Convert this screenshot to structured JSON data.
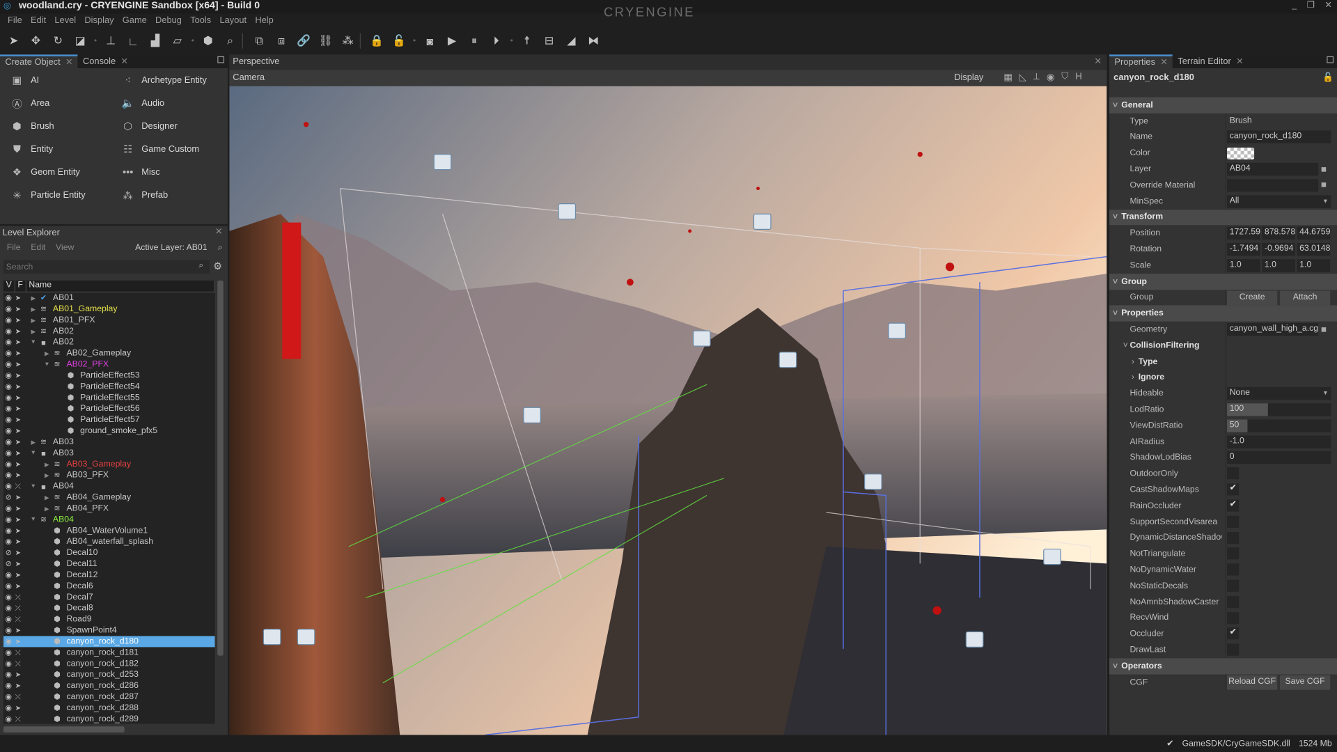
{
  "window": {
    "title": "woodland.cry - CRYENGINE Sandbox [x64] - Build 0",
    "brand": "CRYENGINE",
    "controls": [
      "_",
      "❐",
      "✕"
    ]
  },
  "menu": [
    "File",
    "Edit",
    "Level",
    "Display",
    "Game",
    "Debug",
    "Tools",
    "Layout",
    "Help"
  ],
  "toolbar": [
    {
      "name": "select",
      "g": "➤"
    },
    {
      "name": "move",
      "g": "✥"
    },
    {
      "name": "rotate",
      "g": "↻"
    },
    {
      "name": "scale",
      "g": "◪"
    },
    {
      "name": "dot"
    },
    {
      "name": "snap-grid",
      "g": "⊥"
    },
    {
      "name": "snap-angle",
      "g": "∟"
    },
    {
      "name": "snap-scale",
      "g": "▟"
    },
    {
      "name": "snap-terrain",
      "g": "▱"
    },
    {
      "name": "dot"
    },
    {
      "name": "select-object",
      "g": "⬢"
    },
    {
      "name": "find",
      "g": "⌕"
    },
    {
      "name": "sep"
    },
    {
      "name": "group",
      "g": "⧉"
    },
    {
      "name": "ungroup",
      "g": "⧈"
    },
    {
      "name": "link",
      "g": "🔗"
    },
    {
      "name": "unlink",
      "g": "⛓"
    },
    {
      "name": "attach",
      "g": "⁂"
    },
    {
      "name": "sep"
    },
    {
      "name": "lock",
      "g": "🔒"
    },
    {
      "name": "unlock",
      "g": "🔓"
    },
    {
      "name": "dot"
    },
    {
      "name": "game-mode",
      "g": "◙"
    },
    {
      "name": "play",
      "g": "▶"
    },
    {
      "name": "pause",
      "g": "⏸"
    },
    {
      "name": "step",
      "g": "⏵"
    },
    {
      "name": "dot"
    },
    {
      "name": "ai-physics",
      "g": "☨"
    },
    {
      "name": "ai-navigation",
      "g": "⊟"
    },
    {
      "name": "terrain",
      "g": "◢"
    },
    {
      "name": "vegetation",
      "g": "⧓"
    }
  ],
  "create_object": {
    "tabs": [
      {
        "label": "Create Object",
        "active": true
      },
      {
        "label": "Console",
        "active": false
      }
    ],
    "items": [
      {
        "label": "AI",
        "icon": "ai-icon",
        "g": "▣"
      },
      {
        "label": "Archetype Entity",
        "icon": "archetype-icon",
        "g": "⁖"
      },
      {
        "label": "Area",
        "icon": "area-icon",
        "g": "Ⓐ"
      },
      {
        "label": "Audio",
        "icon": "audio-icon",
        "g": "🔈"
      },
      {
        "label": "Brush",
        "icon": "brush-icon",
        "g": "⬢"
      },
      {
        "label": "Designer",
        "icon": "designer-icon",
        "g": "⬡"
      },
      {
        "label": "Entity",
        "icon": "entity-icon",
        "g": "⛊"
      },
      {
        "label": "Game Custom",
        "icon": "ladder-icon",
        "g": "☷"
      },
      {
        "label": "Geom Entity",
        "icon": "geom-entity-icon",
        "g": "❖"
      },
      {
        "label": "Misc",
        "icon": "misc-icon",
        "g": "•••"
      },
      {
        "label": "Particle Entity",
        "icon": "particle-icon",
        "g": "✳"
      },
      {
        "label": "Prefab",
        "icon": "prefab-icon",
        "g": "⁂"
      }
    ]
  },
  "level_explorer": {
    "title": "Level Explorer",
    "menu": [
      "File",
      "Edit",
      "View"
    ],
    "active_layer": "Active Layer: AB01",
    "search_placeholder": "Search",
    "columns": [
      "V",
      "F",
      "Name"
    ],
    "rows": [
      {
        "n": "AB01",
        "l": 0,
        "e": "r",
        "i": "check",
        "c": ""
      },
      {
        "n": "AB01_Gameplay",
        "l": 0,
        "e": "r",
        "i": "layer",
        "c": "#e6e24a"
      },
      {
        "n": "AB01_PFX",
        "l": 0,
        "e": "r",
        "i": "layer",
        "c": ""
      },
      {
        "n": "AB02",
        "l": 0,
        "e": "r",
        "i": "layer",
        "c": ""
      },
      {
        "n": "AB02",
        "l": 0,
        "e": "d",
        "i": "folder",
        "c": ""
      },
      {
        "n": "AB02_Gameplay",
        "l": 1,
        "e": "r",
        "i": "layer",
        "c": ""
      },
      {
        "n": "AB02_PFX",
        "l": 1,
        "e": "d",
        "i": "layer",
        "c": "#e040e0"
      },
      {
        "n": "ParticleEffect53",
        "l": 2,
        "e": "",
        "i": "obj",
        "c": ""
      },
      {
        "n": "ParticleEffect54",
        "l": 2,
        "e": "",
        "i": "obj",
        "c": ""
      },
      {
        "n": "ParticleEffect55",
        "l": 2,
        "e": "",
        "i": "obj",
        "c": ""
      },
      {
        "n": "ParticleEffect56",
        "l": 2,
        "e": "",
        "i": "obj",
        "c": ""
      },
      {
        "n": "ParticleEffect57",
        "l": 2,
        "e": "",
        "i": "obj",
        "c": ""
      },
      {
        "n": "ground_smoke_pfx5",
        "l": 2,
        "e": "",
        "i": "obj",
        "c": ""
      },
      {
        "n": "AB03",
        "l": 0,
        "e": "r",
        "i": "layer",
        "c": ""
      },
      {
        "n": "AB03",
        "l": 0,
        "e": "d",
        "i": "folder",
        "c": ""
      },
      {
        "n": "AB03_Gameplay",
        "l": 1,
        "e": "r",
        "i": "layer",
        "c": "#e84040"
      },
      {
        "n": "AB03_PFX",
        "l": 1,
        "e": "r",
        "i": "layer",
        "c": ""
      },
      {
        "n": "AB04",
        "l": 0,
        "e": "d",
        "i": "folder",
        "c": "",
        "frozen": true
      },
      {
        "n": "AB04_Gameplay",
        "l": 1,
        "e": "r",
        "i": "layer",
        "c": "",
        "hidden": true
      },
      {
        "n": "AB04_PFX",
        "l": 1,
        "e": "r",
        "i": "layer",
        "c": ""
      },
      {
        "n": "AB04",
        "l": 0,
        "e": "d",
        "i": "layer",
        "c": "#8cf040"
      },
      {
        "n": "AB04_WaterVolume1",
        "l": 1,
        "e": "",
        "i": "obj",
        "c": ""
      },
      {
        "n": "AB04_waterfall_splash",
        "l": 1,
        "e": "",
        "i": "obj",
        "c": ""
      },
      {
        "n": "Decal10",
        "l": 1,
        "e": "",
        "i": "obj",
        "c": "",
        "hidden": true
      },
      {
        "n": "Decal11",
        "l": 1,
        "e": "",
        "i": "obj",
        "c": "",
        "hidden": true
      },
      {
        "n": "Decal12",
        "l": 1,
        "e": "",
        "i": "obj",
        "c": ""
      },
      {
        "n": "Decal6",
        "l": 1,
        "e": "",
        "i": "obj",
        "c": ""
      },
      {
        "n": "Decal7",
        "l": 1,
        "e": "",
        "i": "obj",
        "c": "",
        "frozen": true
      },
      {
        "n": "Decal8",
        "l": 1,
        "e": "",
        "i": "obj",
        "c": "",
        "frozen": true
      },
      {
        "n": "Road9",
        "l": 1,
        "e": "",
        "i": "obj",
        "c": "",
        "frozen": true
      },
      {
        "n": "SpawnPoint4",
        "l": 1,
        "e": "",
        "i": "obj",
        "c": ""
      },
      {
        "n": "canyon_rock_d180",
        "l": 1,
        "e": "",
        "i": "obj",
        "c": "",
        "selected": true
      },
      {
        "n": "canyon_rock_d181",
        "l": 1,
        "e": "",
        "i": "obj",
        "c": "",
        "frozen": true
      },
      {
        "n": "canyon_rock_d182",
        "l": 1,
        "e": "",
        "i": "obj",
        "c": "",
        "frozen": true
      },
      {
        "n": "canyon_rock_d253",
        "l": 1,
        "e": "",
        "i": "obj",
        "c": ""
      },
      {
        "n": "canyon_rock_d286",
        "l": 1,
        "e": "",
        "i": "obj",
        "c": ""
      },
      {
        "n": "canyon_rock_d287",
        "l": 1,
        "e": "",
        "i": "obj",
        "c": "",
        "frozen": true
      },
      {
        "n": "canyon_rock_d288",
        "l": 1,
        "e": "",
        "i": "obj",
        "c": ""
      },
      {
        "n": "canyon_rock_d289",
        "l": 1,
        "e": "",
        "i": "obj",
        "c": "",
        "frozen": true
      }
    ]
  },
  "viewport": {
    "title": "Perspective",
    "camera": "Camera",
    "display": "Display",
    "icons": [
      "grid-icon",
      "angle-snap-icon",
      "axis-icon",
      "circle-icon",
      "helpers-icon"
    ],
    "h_label": "H"
  },
  "properties": {
    "tabs": [
      {
        "label": "Properties",
        "active": true
      },
      {
        "label": "Terrain Editor",
        "active": false
      }
    ],
    "object_name": "canyon_rock_d180",
    "rows": [
      {
        "k": "sec",
        "label": "General"
      },
      {
        "k": "text",
        "label": "Type",
        "value": "Brush"
      },
      {
        "k": "field",
        "label": "Name",
        "value": "canyon_rock_d180"
      },
      {
        "k": "color",
        "label": "Color"
      },
      {
        "k": "folder",
        "label": "Layer",
        "value": "AB04"
      },
      {
        "k": "folder",
        "label": "Override Material",
        "value": ""
      },
      {
        "k": "combo",
        "label": "MinSpec",
        "value": "All"
      },
      {
        "k": "sec",
        "label": "Transform"
      },
      {
        "k": "vec",
        "label": "Position",
        "values": [
          "1727.59",
          "878.578",
          "44.6759"
        ]
      },
      {
        "k": "vec",
        "label": "Rotation",
        "values": [
          "-1.7494",
          "-0.9694",
          "63.0148"
        ]
      },
      {
        "k": "vec",
        "label": "Scale",
        "values": [
          "1.0",
          "1.0",
          "1.0"
        ]
      },
      {
        "k": "sec",
        "label": "Group"
      },
      {
        "k": "btns",
        "label": "Group",
        "values": [
          "Create",
          "Attach"
        ]
      },
      {
        "k": "sec",
        "label": "Properties"
      },
      {
        "k": "folder",
        "label": "Geometry",
        "value": "canyon_wall_high_a.cgf"
      },
      {
        "k": "sub",
        "label": "CollisionFiltering",
        "exp": "d"
      },
      {
        "k": "sub2",
        "label": "Type",
        "exp": "r"
      },
      {
        "k": "sub2",
        "label": "Ignore",
        "exp": "r"
      },
      {
        "k": "combo",
        "label": "Hideable",
        "value": "None"
      },
      {
        "k": "slider",
        "label": "LodRatio",
        "value": "100",
        "fill": 0.39
      },
      {
        "k": "slider",
        "label": "ViewDistRatio",
        "value": "50",
        "fill": 0.2
      },
      {
        "k": "field",
        "label": "AIRadius",
        "value": "-1.0"
      },
      {
        "k": "field",
        "label": "ShadowLodBias",
        "value": "0"
      },
      {
        "k": "check",
        "label": "OutdoorOnly",
        "checked": false
      },
      {
        "k": "check",
        "label": "CastShadowMaps",
        "checked": true
      },
      {
        "k": "check",
        "label": "RainOccluder",
        "checked": true
      },
      {
        "k": "check",
        "label": "SupportSecondVisarea",
        "checked": false
      },
      {
        "k": "check",
        "label": "DynamicDistanceShadows",
        "checked": false
      },
      {
        "k": "check",
        "label": "NotTriangulate",
        "checked": false
      },
      {
        "k": "check",
        "label": "NoDynamicWater",
        "checked": false
      },
      {
        "k": "check",
        "label": "NoStaticDecals",
        "checked": false
      },
      {
        "k": "check",
        "label": "NoAmnbShadowCaster",
        "checked": false
      },
      {
        "k": "check",
        "label": "RecvWind",
        "checked": false
      },
      {
        "k": "check",
        "label": "Occluder",
        "checked": true
      },
      {
        "k": "check",
        "label": "DrawLast",
        "checked": false
      },
      {
        "k": "sec",
        "label": "Operators"
      },
      {
        "k": "btns",
        "label": "CGF",
        "values": [
          "Reload CGF",
          "Save CGF"
        ]
      }
    ]
  },
  "status": {
    "dll": "GameSDK/CryGameSDK.dll",
    "memory": "1524 Mb"
  },
  "colors": {
    "accent": "#4a90d0",
    "selection": "#5aa8e6",
    "panel": "#333333"
  }
}
